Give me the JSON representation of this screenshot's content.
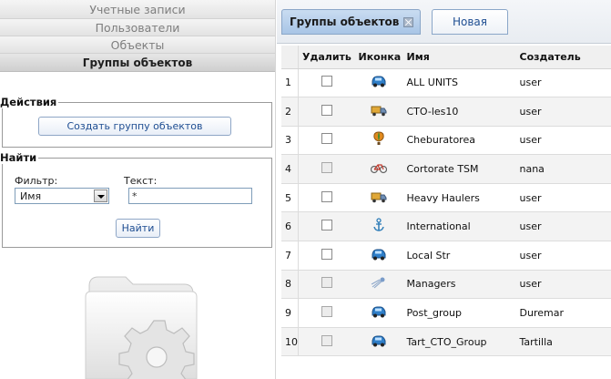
{
  "sidebar": {
    "nav": [
      {
        "label": "Учетные записи"
      },
      {
        "label": "Пользователи"
      },
      {
        "label": "Объекты"
      },
      {
        "label": "Группы объектов"
      }
    ],
    "actions": {
      "legend": "Действия",
      "create_button": "Создать группу объектов"
    },
    "find": {
      "legend": "Найти",
      "filter_label": "Фильтр:",
      "filter_value": "Имя",
      "text_label": "Текст:",
      "text_value": "*",
      "find_button": "Найти"
    },
    "image_icon": "folder-gear-icon"
  },
  "tabs": [
    {
      "label": "Группы объектов",
      "active": true
    },
    {
      "label": "Новая",
      "active": false
    }
  ],
  "table": {
    "columns": [
      "",
      "Удалить",
      "Иконка",
      "Имя",
      "Создатель"
    ],
    "rows": [
      {
        "num": "1",
        "checkbox_enabled": true,
        "icon": "blue-car-icon",
        "name": "ALL UNITS",
        "creator": "user"
      },
      {
        "num": "2",
        "checkbox_enabled": true,
        "icon": "truck-icon",
        "name": "CTO-les10",
        "creator": "user"
      },
      {
        "num": "3",
        "checkbox_enabled": true,
        "icon": "balloon-icon",
        "name": "Cheburatorea",
        "creator": "user"
      },
      {
        "num": "4",
        "checkbox_enabled": false,
        "icon": "bicycle-icon",
        "name": "Cortorate TSM",
        "creator": "nana"
      },
      {
        "num": "5",
        "checkbox_enabled": true,
        "icon": "truck-icon",
        "name": "Heavy Haulers",
        "creator": "user"
      },
      {
        "num": "6",
        "checkbox_enabled": true,
        "icon": "anchor-icon",
        "name": "International",
        "creator": "user"
      },
      {
        "num": "7",
        "checkbox_enabled": true,
        "icon": "blue-car-icon",
        "name": "Local Str",
        "creator": "user"
      },
      {
        "num": "8",
        "checkbox_enabled": false,
        "icon": "comet-icon",
        "name": "Managers",
        "creator": "user"
      },
      {
        "num": "9",
        "checkbox_enabled": false,
        "icon": "blue-car-icon",
        "name": "Post_group",
        "creator": "Duremar"
      },
      {
        "num": "10",
        "checkbox_enabled": false,
        "icon": "blue-car-icon",
        "name": "Tart_CTO_Group",
        "creator": "Tartilla"
      }
    ]
  },
  "colors": {
    "accent": "#1f4e92",
    "tab_active": "#b8d0ec",
    "row_alt": "#f3f3f3"
  }
}
